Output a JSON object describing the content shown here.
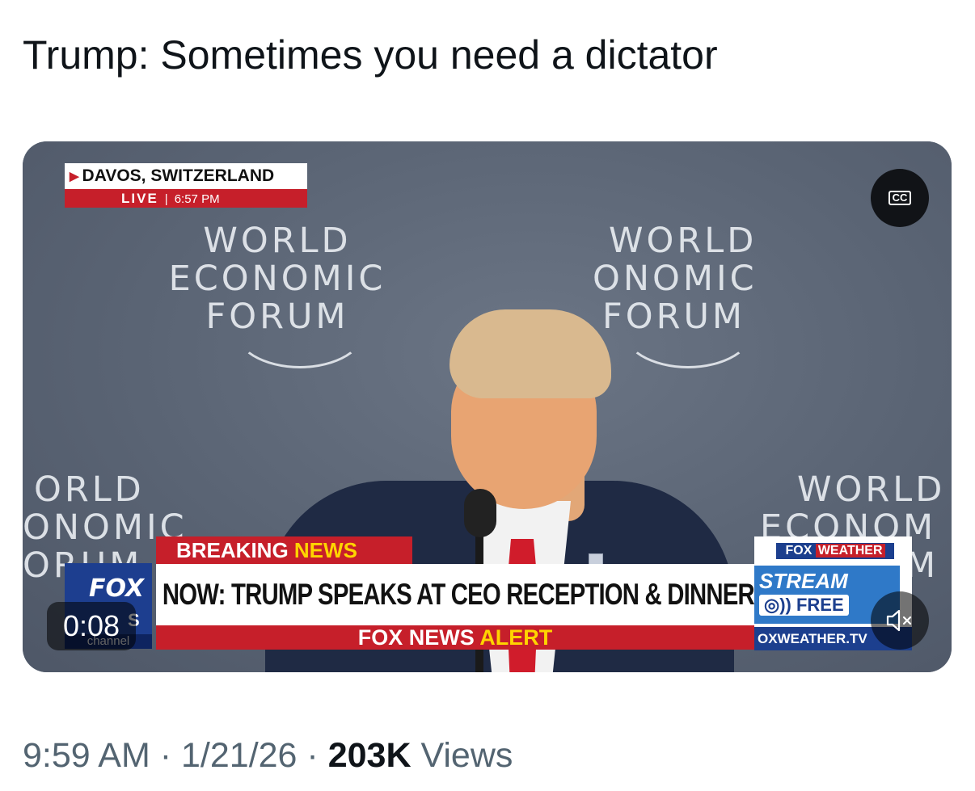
{
  "post": {
    "text": "Trump: Sometimes you need a dictator"
  },
  "video": {
    "location": "DAVOS, SWITZERLAND",
    "live_label": "LIVE",
    "live_separator": "|",
    "live_time": "6:57 PM",
    "backdrop_logo": {
      "line1": "WORLD",
      "line2": "ECONOMIC",
      "line3": "FORUM"
    },
    "backdrop_partial": {
      "right_line1": "WORLD",
      "right_line2": "ONOMIC",
      "right_line3": "FORUM",
      "left_line1": "ORLD",
      "left_line2": "ONOMIC",
      "left_line3": "ORUM",
      "far_right_line1": "WORLD",
      "far_right_line2": "ECONOM",
      "far_right_line3": "M"
    },
    "breaking_white": "BREAKING",
    "breaking_yellow": "NEWS",
    "headline": "NOW: TRUMP SPEAKS AT CEO RECEPTION & DINNER",
    "alert_white": "FOX NEWS",
    "alert_yellow": "ALERT",
    "channel_logo_top": "FOX",
    "channel_logo_mid": "S",
    "channel_logo_bottom": "channel",
    "weather_logo_fox": "FOX",
    "weather_logo_weather": "WEATHER",
    "weather_stream": "STREAM",
    "weather_free": "FREE",
    "weather_url": "OXWEATHER.TV",
    "cc_label": "CC",
    "elapsed": "0:08"
  },
  "meta": {
    "time": "9:59 AM",
    "sep1": "·",
    "date": "1/21/26",
    "sep2": "·",
    "views_count": "203K",
    "views_label": "Views"
  },
  "colors": {
    "fox_red": "#c61f2a",
    "fox_blue": "#1d3e8f",
    "fox_yellow": "#ffd400",
    "meta_gray": "#536471"
  },
  "icons": [
    "closed-captions-icon",
    "mute-icon",
    "fox-news-channel-logo",
    "fox-weather-logo"
  ]
}
